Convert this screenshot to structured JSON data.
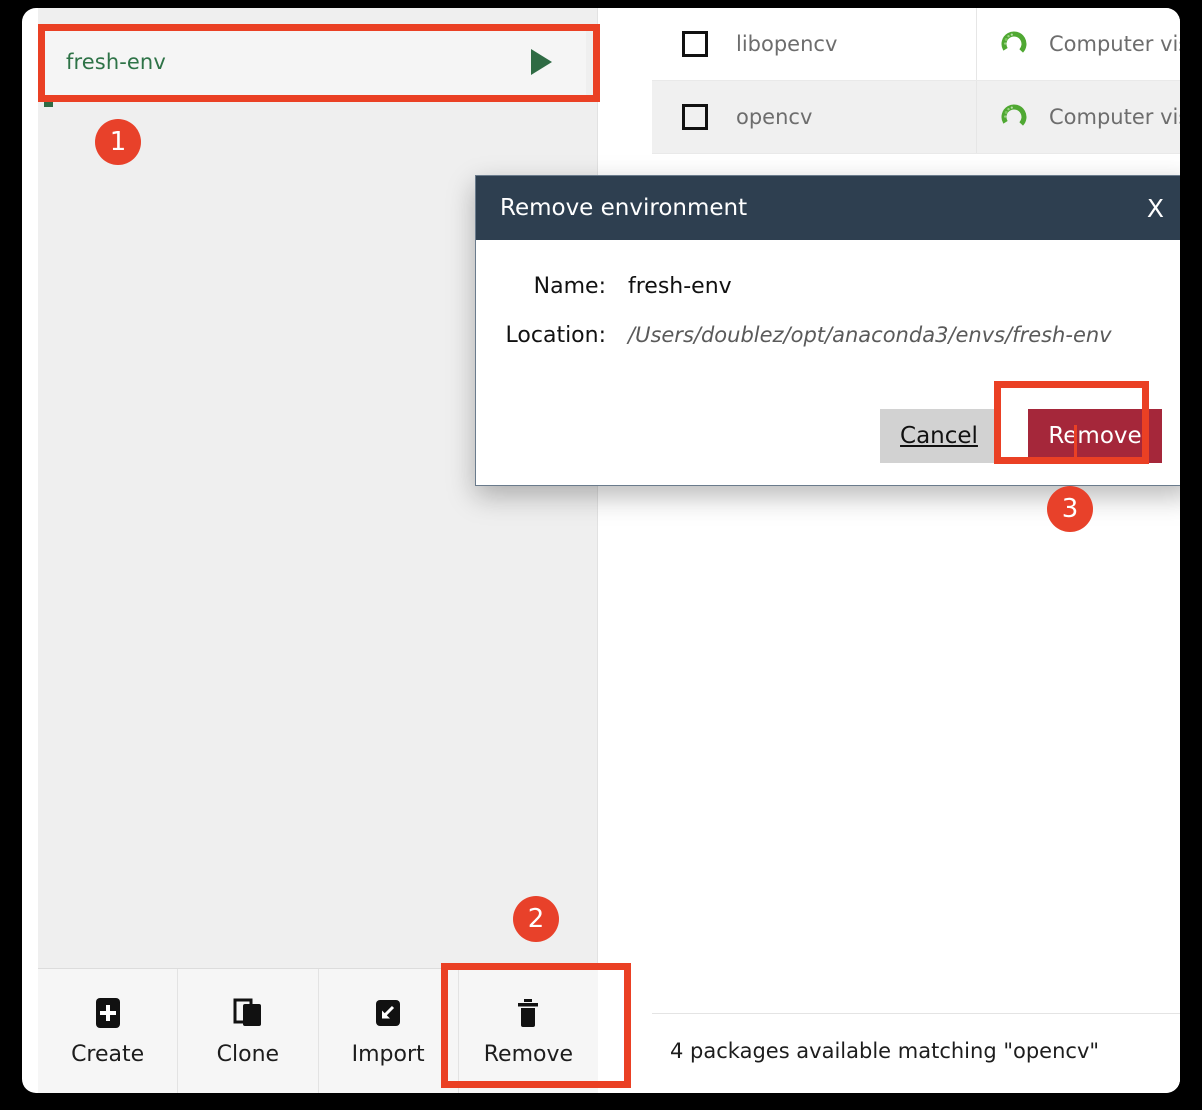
{
  "environments_panel": {
    "selected_env": {
      "name": "fresh-env",
      "run_icon": "play-triangle-icon"
    },
    "toolbar": {
      "buttons": [
        {
          "label": "Create",
          "icon": "plus-square-icon"
        },
        {
          "label": "Clone",
          "icon": "copy-icon"
        },
        {
          "label": "Import",
          "icon": "import-arrow-icon"
        },
        {
          "label": "Remove",
          "icon": "trash-icon"
        }
      ]
    }
  },
  "packages_panel": {
    "rows": [
      {
        "checkbox": "unchecked",
        "name": "libopencv",
        "source_icon": "conda-ring-icon",
        "description": "Computer vision"
      },
      {
        "checkbox": "unchecked",
        "name": "opencv",
        "source_icon": "conda-ring-icon",
        "description": "Computer vision"
      }
    ],
    "status_text": "4 packages available matching \"opencv\""
  },
  "dialog": {
    "title": "Remove environment",
    "close_label": "X",
    "fields": [
      {
        "label": "Name:",
        "value": "fresh-env"
      },
      {
        "label": "Location:",
        "value": "/Users/doublez/opt/anaconda3/envs/fresh-env"
      }
    ],
    "cancel_label": "Cancel",
    "remove_label": "Remove"
  },
  "annotations": {
    "badges": [
      {
        "number": "1"
      },
      {
        "number": "2"
      },
      {
        "number": "3"
      }
    ],
    "highlight_color": "#ea4024",
    "badge_color": "#e8412a"
  }
}
